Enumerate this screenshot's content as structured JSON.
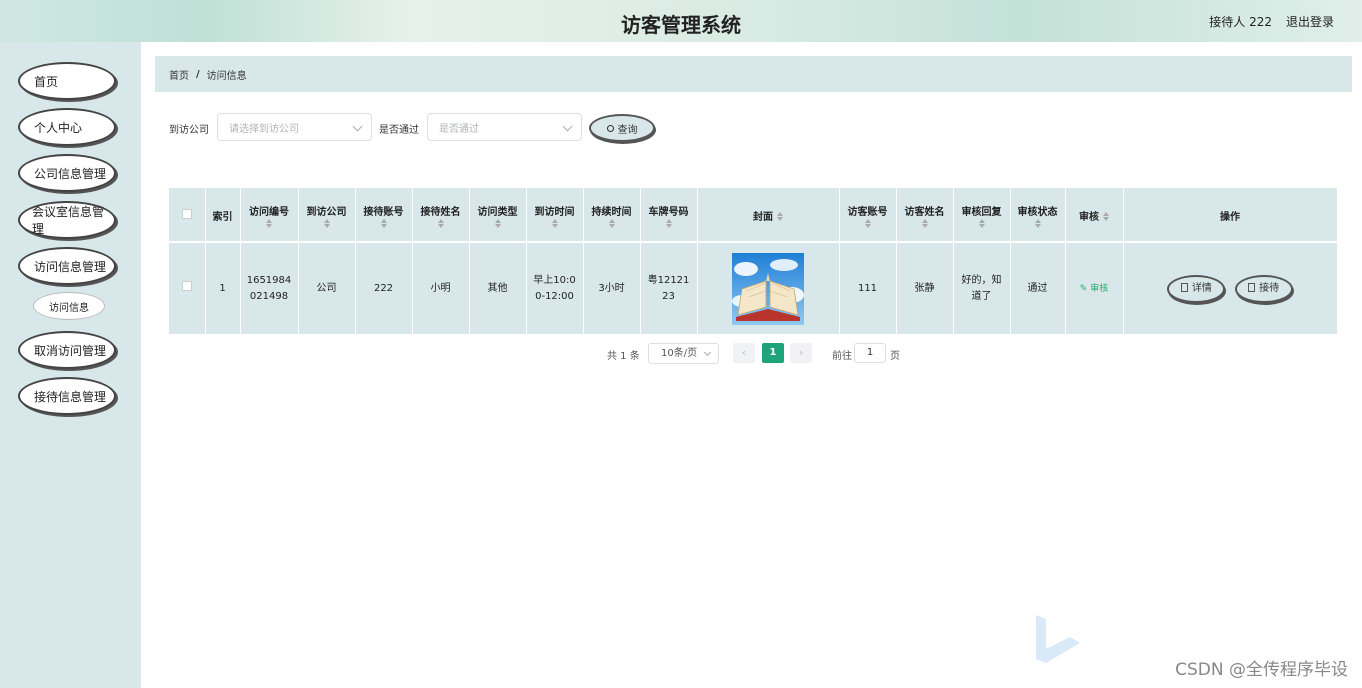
{
  "header": {
    "title": "访客管理系统",
    "user": "接待人 222",
    "logout": "退出登录"
  },
  "sidebar": {
    "items": [
      {
        "label": "首页"
      },
      {
        "label": "个人中心"
      },
      {
        "label": "公司信息管理"
      },
      {
        "label": "会议室信息管理"
      },
      {
        "label": "访问信息管理"
      },
      {
        "label": "访问信息"
      },
      {
        "label": "取消访问管理"
      },
      {
        "label": "接待信息管理"
      }
    ]
  },
  "breadcrumb": {
    "home": "首页",
    "separator": "/",
    "current": "访问信息"
  },
  "filters": {
    "company_label": "到访公司",
    "company_placeholder": "请选择到访公司",
    "pass_label": "是否通过",
    "pass_placeholder": "是否通过",
    "query_button": "查询"
  },
  "table": {
    "headers": [
      "索引",
      "访问编号",
      "到访公司",
      "接待账号",
      "接待姓名",
      "访问类型",
      "到访时间",
      "持续时间",
      "车牌号码",
      "封面",
      "访客账号",
      "访客姓名",
      "审核回复",
      "审核状态",
      "审核",
      "操作"
    ],
    "rows": [
      {
        "index": "1",
        "visit_no": "1651984021498",
        "company": "公司",
        "host_account": "222",
        "host_name": "小明",
        "visit_type": "其他",
        "visit_time": "早上10:00-12:00",
        "duration": "3小时",
        "plate": "粤1212123",
        "visitor_account": "111",
        "visitor_name": "张静",
        "reply": "好的，知道了",
        "status": "通过",
        "audit": "审核",
        "detail_button": "详情",
        "reception_button": "接待"
      }
    ]
  },
  "pagination": {
    "total": "共 1 条",
    "page_size": "10条/页",
    "current_page": "1",
    "goto_label": "前往",
    "goto_value": "1",
    "goto_suffix": "页"
  },
  "watermark": "CSDN @全传程序毕设"
}
